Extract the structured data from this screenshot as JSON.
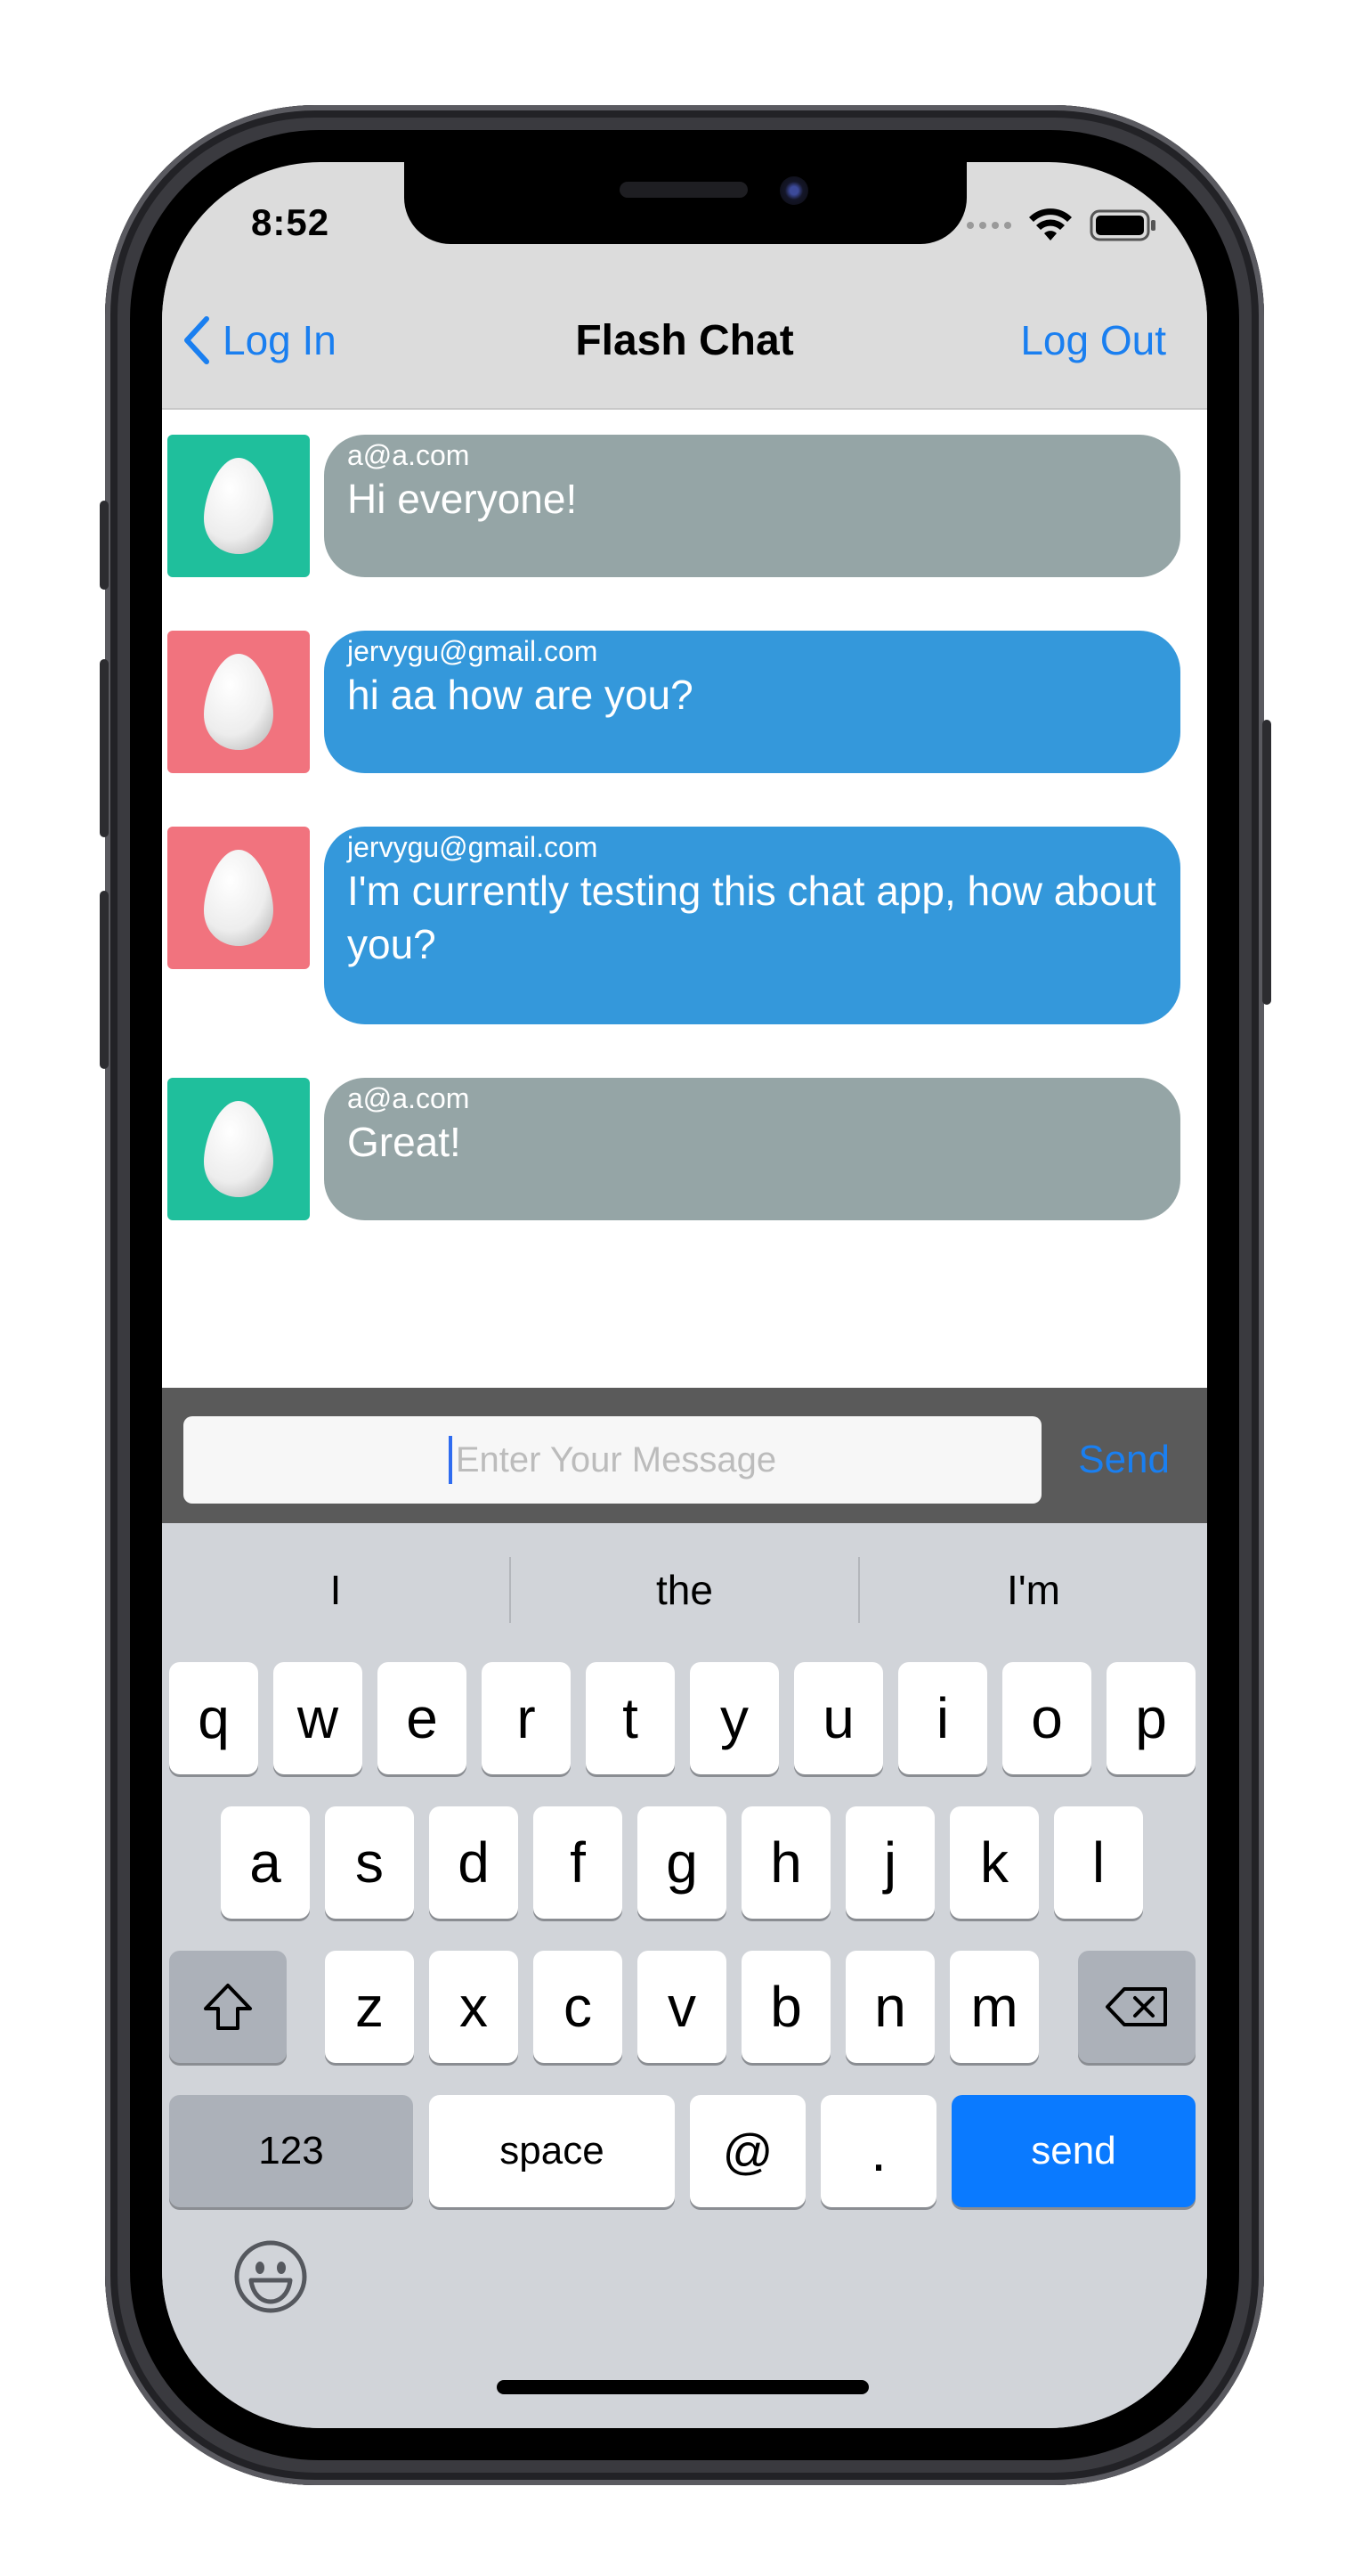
{
  "status_bar": {
    "time": "8:52"
  },
  "navbar": {
    "back_label": "Log In",
    "title": "Flash Chat",
    "right_label": "Log Out"
  },
  "messages": [
    {
      "sender": "a@a.com",
      "text": "Hi everyone!",
      "avatar_color": "#1fbf9c",
      "bubble_color": "#95a5a6"
    },
    {
      "sender": "jervygu@gmail.com",
      "text": "hi aa how are you?",
      "avatar_color": "#f1737e",
      "bubble_color": "#3498db"
    },
    {
      "sender": "jervygu@gmail.com",
      "text": "I'm currently testing this chat app, how about you?",
      "avatar_color": "#f1737e",
      "bubble_color": "#3498db"
    },
    {
      "sender": "a@a.com",
      "text": "Great!",
      "avatar_color": "#1fbf9c",
      "bubble_color": "#95a5a6"
    }
  ],
  "input": {
    "placeholder": "Enter Your Message",
    "send_label": "Send"
  },
  "keyboard": {
    "suggestions": [
      "I",
      "the",
      "I'm"
    ],
    "row1": [
      "q",
      "w",
      "e",
      "r",
      "t",
      "y",
      "u",
      "i",
      "o",
      "p"
    ],
    "row2": [
      "a",
      "s",
      "d",
      "f",
      "g",
      "h",
      "j",
      "k",
      "l"
    ],
    "row3": [
      "z",
      "x",
      "c",
      "v",
      "b",
      "n",
      "m"
    ],
    "numbers_label": "123",
    "space_label": "space",
    "at_label": "@",
    "period_label": ".",
    "send_label": "send",
    "icons": {
      "shift": "shift-icon",
      "backspace": "backspace-icon",
      "emoji": "emoji-icon"
    }
  },
  "colors": {
    "accent": "#1a7ff0",
    "send_key": "#0a7aff",
    "input_bar": "#5a5a5a",
    "keyboard_bg": "#d1d4d9"
  }
}
